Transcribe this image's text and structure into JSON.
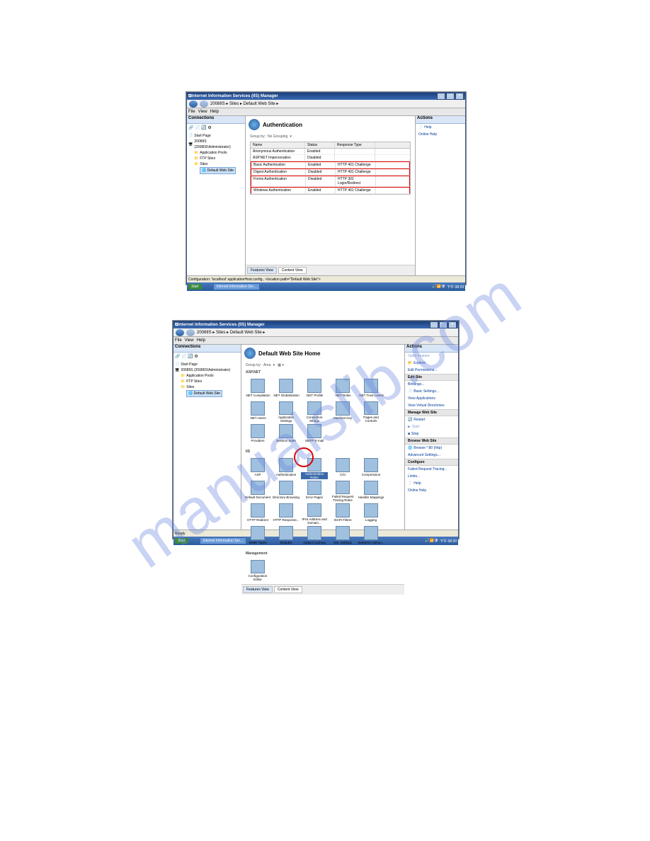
{
  "watermark": "manualslib.com",
  "shot1": {
    "title": "Internet Information Services (IIS) Manager",
    "breadcrumb": [
      "2008IIS",
      "Sites",
      "Default Web Site"
    ],
    "menu": [
      "File",
      "View",
      "Help"
    ],
    "left_header": "Connections",
    "tree": {
      "start": "Start Page",
      "server": "2008IIS (2008IIS\\Administrator)",
      "apppools": "Application Pools",
      "ftpsites": "FTP Sites",
      "sites": "Sites",
      "default": "Default Web Site"
    },
    "center_title": "Authentication",
    "group_label": "Group by:",
    "group_value": "No Grouping",
    "columns": {
      "c1": "Name",
      "c2": "Status",
      "c3": "Response Type"
    },
    "rows": [
      {
        "name": "Anonymous Authentication",
        "status": "Enabled",
        "resp": "",
        "hl": false
      },
      {
        "name": "ASP.NET Impersonation",
        "status": "Disabled",
        "resp": "",
        "hl": false
      },
      {
        "name": "Basic Authentication",
        "status": "Enabled",
        "resp": "HTTP 401 Challenge",
        "hl": true
      },
      {
        "name": "Digest Authentication",
        "status": "Disabled",
        "resp": "HTTP 401 Challenge",
        "hl": true
      },
      {
        "name": "Forms Authentication",
        "status": "Disabled",
        "resp": "HTTP 302 Login/Redirect",
        "hl": true
      },
      {
        "name": "Windows Authentication",
        "status": "Enabled",
        "resp": "HTTP 401 Challenge",
        "hl": true
      }
    ],
    "tab_features": "Features View",
    "tab_content": "Content View",
    "config_text": "Configuration: 'localhost' applicationHost.config , <location path=\"Default Web Site\">",
    "right_header": "Actions",
    "actions": {
      "help": "Help",
      "online": "Online Help"
    },
    "task_app": "Internet Information Ser...",
    "tray_time": "下午 08:29",
    "start": "Start"
  },
  "shot2": {
    "title": "Internet Information Services (IIS) Manager",
    "breadcrumb": [
      "2008IIS",
      "Sites",
      "Default Web Site"
    ],
    "menu": [
      "File",
      "View",
      "Help"
    ],
    "left_header": "Connections",
    "tree": {
      "start": "Start Page",
      "server": "2008IIS (2008IIS\\Administrator)",
      "apppools": "Application Pools",
      "ftpsites": "FTP Sites",
      "sites": "Sites",
      "default": "Default Web Site"
    },
    "center_title": "Default Web Site Home",
    "group_label": "Group by:",
    "group_value": "Area",
    "sec_aspnet": "ASP.NET",
    "sec_iis": "IIS",
    "sec_mgmt": "Management",
    "icons_aspnet": [
      ".NET Compilation",
      ".NET Globalization",
      ".NET Profile",
      ".NET Roles",
      ".NET Trust Levels",
      ".NET Users",
      "Application Settings",
      "Connection Strings",
      "Machine Key",
      "Pages and Controls",
      "Providers",
      "Session State",
      "SMTP E-mail"
    ],
    "icons_iis": [
      "ASP",
      "Authentication",
      "Authorization Rules",
      "CGI",
      "Compression",
      "Default Document",
      "Directory Browsing",
      "Error Pages",
      "Failed Request Tracing Rules",
      "Handler Mappings",
      "HTTP Redirect",
      "HTTP Response...",
      "IPv4 Address and Domain...",
      "ISAPI Filters",
      "Logging",
      "MIME Types",
      "Modules",
      "Output Caching",
      "SSL Settings",
      "WebDAV Authori..."
    ],
    "icons_mgmt": [
      "Configuration Editor"
    ],
    "tab_features": "Features View",
    "tab_content": "Content View",
    "status": "Ready",
    "right_header": "Actions",
    "actions": {
      "open": "Open Feature",
      "explore": "Explore",
      "editperm": "Edit Permissions...",
      "grp_edit": "Edit Site",
      "bindings": "Bindings...",
      "basic": "Basic Settings...",
      "viewapp": "View Applications",
      "viewvdir": "View Virtual Directories",
      "grp_manage": "Manage Web Site",
      "restart": "Restart",
      "start": "Start",
      "stop": "Stop",
      "grp_browse": "Browse Web Site",
      "browse80": "Browse *:80 (http)",
      "adv": "Advanced Settings...",
      "grp_conf": "Configure",
      "failed": "Failed Request Tracing...",
      "limits": "Limits...",
      "help": "Help",
      "online": "Online Help"
    },
    "task_app": "Internet Information Ser...",
    "tray_time": "下午 08:30",
    "start": "Start"
  }
}
